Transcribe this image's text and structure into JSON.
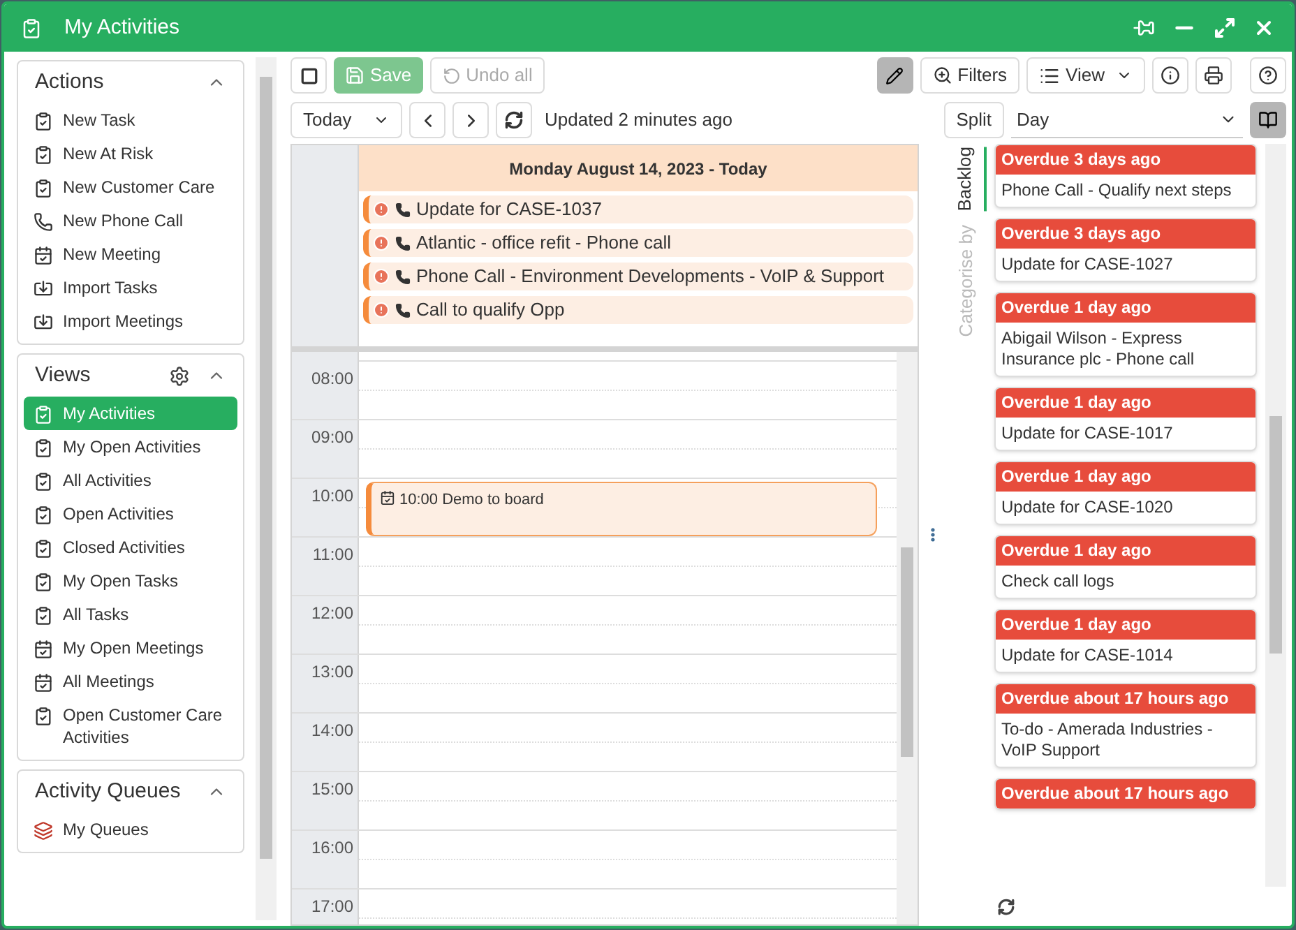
{
  "window": {
    "title": "My Activities"
  },
  "sidebar": {
    "sections": [
      {
        "title": "Actions",
        "settings": false,
        "items": [
          {
            "label": "New Task",
            "kind": "task",
            "selected": false
          },
          {
            "label": "New At Risk",
            "kind": "task",
            "selected": false
          },
          {
            "label": "New Customer Care",
            "kind": "task",
            "selected": false
          },
          {
            "label": "New Phone Call",
            "kind": "phone",
            "selected": false
          },
          {
            "label": "New Meeting",
            "kind": "meeting",
            "selected": false
          },
          {
            "label": "Import Tasks",
            "kind": "import",
            "selected": false
          },
          {
            "label": "Import Meetings",
            "kind": "import",
            "selected": false
          }
        ]
      },
      {
        "title": "Views",
        "settings": true,
        "items": [
          {
            "label": "My Activities",
            "kind": "task",
            "selected": true
          },
          {
            "label": "My Open Activities",
            "kind": "task",
            "selected": false
          },
          {
            "label": "All Activities",
            "kind": "task",
            "selected": false
          },
          {
            "label": "Open Activities",
            "kind": "task",
            "selected": false
          },
          {
            "label": "Closed Activities",
            "kind": "task",
            "selected": false
          },
          {
            "label": "My Open Tasks",
            "kind": "task",
            "selected": false
          },
          {
            "label": "All Tasks",
            "kind": "task",
            "selected": false
          },
          {
            "label": "My Open Meetings",
            "kind": "meeting",
            "selected": false
          },
          {
            "label": "All Meetings",
            "kind": "meeting",
            "selected": false
          },
          {
            "label": "Open Customer Care Activities",
            "kind": "task",
            "selected": false
          }
        ]
      },
      {
        "title": "Activity Queues",
        "settings": false,
        "items": [
          {
            "label": "My Queues",
            "kind": "queue",
            "selected": false
          }
        ]
      }
    ]
  },
  "toolbar": {
    "save": "Save",
    "undo": "Undo all",
    "filters": "Filters",
    "view": "View",
    "edit_active": true
  },
  "nav": {
    "range": "Today",
    "status": "Updated 2 minutes ago",
    "split": "Split",
    "mode": "Day"
  },
  "calendar": {
    "date_header": "Monday August 14, 2023 - Today",
    "all_day": [
      {
        "title": "Update for CASE-1037"
      },
      {
        "title": "Atlantic - office refit - Phone call"
      },
      {
        "title": "Phone Call - Environment Developments - VoIP & Support"
      },
      {
        "title": "Call to qualify Opp"
      }
    ],
    "hours": [
      {
        "label": "08:00"
      },
      {
        "label": "09:00"
      },
      {
        "label": "10:00",
        "events": [
          {
            "title": "10:00 Demo to board"
          }
        ]
      },
      {
        "label": "11:00"
      },
      {
        "label": "12:00"
      },
      {
        "label": "13:00"
      },
      {
        "label": "14:00"
      },
      {
        "label": "15:00"
      },
      {
        "label": "16:00"
      },
      {
        "label": "17:00"
      }
    ]
  },
  "backlog": {
    "tabs": [
      {
        "label": "Backlog",
        "selected": true
      },
      {
        "label": "Categorise by",
        "selected": false
      }
    ],
    "cards": [
      {
        "header": "Overdue 3 days ago",
        "body": "Phone Call - Qualify next steps"
      },
      {
        "header": "Overdue 3 days ago",
        "body": "Update for CASE-1027"
      },
      {
        "header": "Overdue 1 day ago",
        "body": "Abigail Wilson - Express Insurance plc - Phone call"
      },
      {
        "header": "Overdue 1 day ago",
        "body": "Update for CASE-1017"
      },
      {
        "header": "Overdue 1 day ago",
        "body": "Update for CASE-1020"
      },
      {
        "header": "Overdue 1 day ago",
        "body": "Check call logs"
      },
      {
        "header": "Overdue 1 day ago",
        "body": "Update for CASE-1014"
      },
      {
        "header": "Overdue about 17 hours ago",
        "body": "To-do - Amerada Industries - VoIP Support"
      },
      {
        "header": "Overdue about 17 hours ago"
      }
    ]
  }
}
